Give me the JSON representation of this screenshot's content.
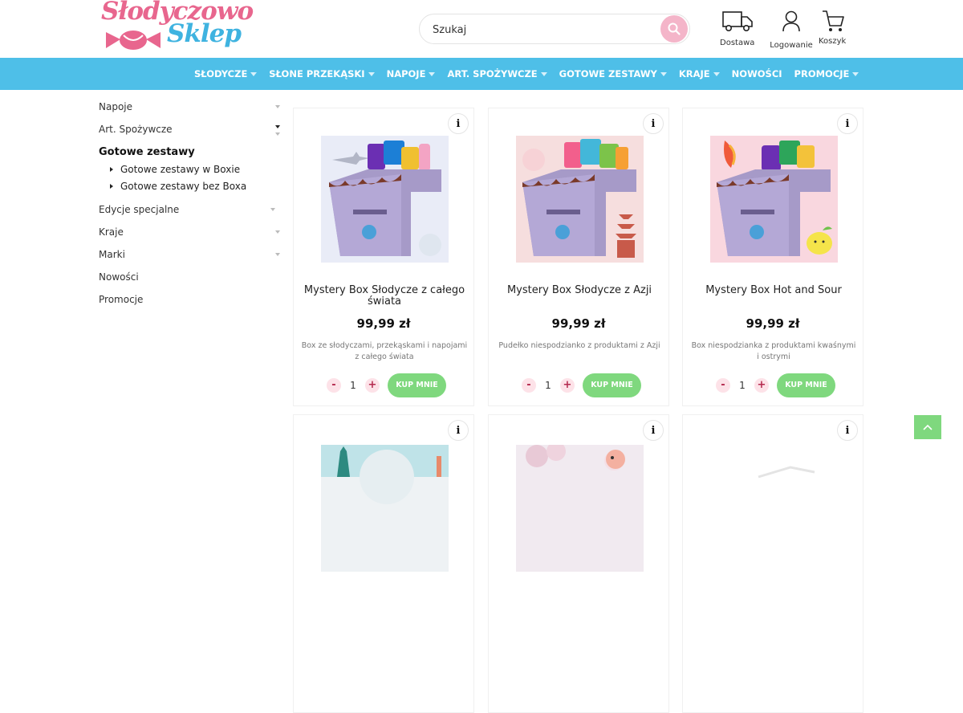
{
  "header": {
    "logo_line1": "Słodyczowo",
    "logo_line2": "Sklep",
    "search_placeholder": "Szukaj",
    "icons": [
      {
        "name": "delivery-truck-icon",
        "label": "Dostawa"
      },
      {
        "name": "user-icon",
        "label": "Logowanie"
      },
      {
        "name": "cart-icon",
        "label": "Koszyk"
      }
    ]
  },
  "nav": {
    "items": [
      {
        "label": "SŁODYCZE",
        "has_dropdown": true
      },
      {
        "label": "SŁONE PRZEKĄSKI",
        "has_dropdown": true
      },
      {
        "label": "NAPOJE",
        "has_dropdown": true
      },
      {
        "label": "ART. SPOŻYWCZE",
        "has_dropdown": true
      },
      {
        "label": "GOTOWE ZESTAWY",
        "has_dropdown": true
      },
      {
        "label": "KRAJE",
        "has_dropdown": true
      },
      {
        "label": "NOWOŚCI",
        "has_dropdown": false
      },
      {
        "label": "PROMOCJE",
        "has_dropdown": true
      }
    ]
  },
  "sidebar": {
    "items": [
      {
        "label": "Napoje"
      },
      {
        "label": "Art. Spożywcze"
      },
      {
        "label": "Gotowe zestawy",
        "active": true,
        "children": [
          "Gotowe zestawy w Boxie",
          "Gotowe zestawy bez Boxa"
        ]
      },
      {
        "label": "Edycje specjalne"
      },
      {
        "label": "Kraje"
      },
      {
        "label": "Marki"
      },
      {
        "label": "Nowości"
      },
      {
        "label": "Promocje"
      }
    ]
  },
  "products": [
    {
      "name": "Mystery Box Słodycze z całego świata",
      "price": "99,99 zł",
      "description": "Box ze słodyczami, przekąskami i napojami z całego świata",
      "quantity": "1",
      "buy_label": "KUP MNIE",
      "info": "i",
      "bg": "#e9ecf7"
    },
    {
      "name": "Mystery Box Słodycze z Azji",
      "price": "99,99 zł",
      "description": "Pudełko niespodzianko z produktami z Azji",
      "quantity": "1",
      "buy_label": "KUP MNIE",
      "info": "i",
      "bg": "#f6dede"
    },
    {
      "name": "Mystery Box Hot and Sour",
      "price": "99,99 zł",
      "description": "Box niespodzianka z produktami kwaśnymi i ostrymi",
      "quantity": "1",
      "buy_label": "KUP MNIE",
      "info": "i",
      "bg": "#f9d7df"
    }
  ],
  "products_row2": [
    {
      "info": "i"
    },
    {
      "info": "i"
    },
    {
      "info": "i"
    }
  ],
  "colors": {
    "nav_bg": "#4ebfe8",
    "buy_button": "#7fd87e",
    "logo_pink": "#e8668e",
    "logo_blue": "#3fb3e0"
  }
}
